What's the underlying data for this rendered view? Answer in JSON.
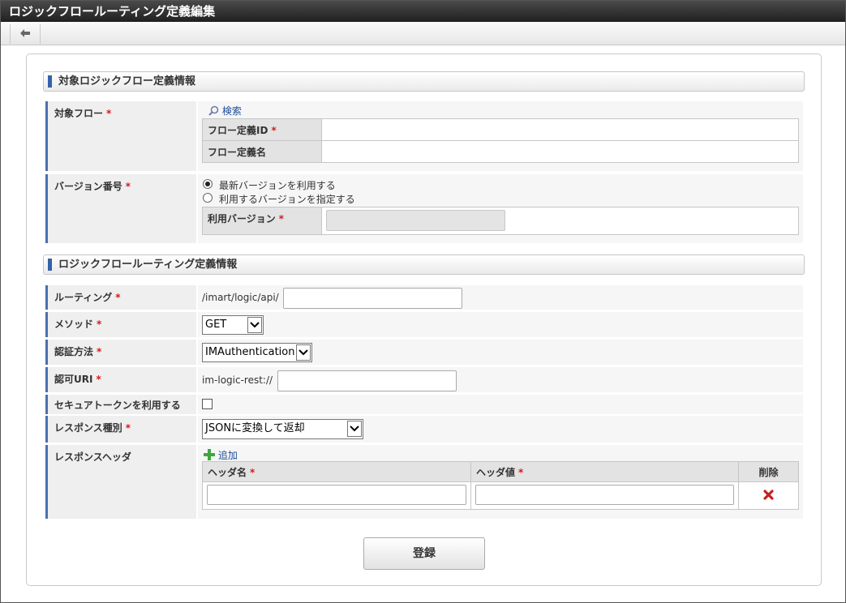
{
  "window": {
    "title": "ロジックフロールーティング定義編集"
  },
  "toolbar": {
    "back_icon": "arrow-left-icon"
  },
  "sections": {
    "target": "対象ロジックフロー定義情報",
    "routing": "ロジックフロールーティング定義情報"
  },
  "required_mark": "*",
  "target_flow": {
    "label": "対象フロー",
    "search_link": "検索",
    "flow_id_label": "フロー定義ID",
    "flow_id_value": "",
    "flow_name_label": "フロー定義名",
    "flow_name_value": ""
  },
  "version": {
    "label": "バージョン番号",
    "option_latest": "最新バージョンを利用する",
    "option_specify": "利用するバージョンを指定する",
    "selected": "latest",
    "use_version_label": "利用バージョン",
    "use_version_value": ""
  },
  "routing": {
    "label": "ルーティング",
    "prefix": "/imart/logic/api/",
    "value": ""
  },
  "method": {
    "label": "メソッド",
    "value": "GET"
  },
  "auth_method": {
    "label": "認証方法",
    "value": "IMAuthentication"
  },
  "auth_uri": {
    "label": "認可URI",
    "prefix": "im-logic-rest://",
    "value": ""
  },
  "secure_token": {
    "label": "セキュアトークンを利用する",
    "checked": false
  },
  "response_type": {
    "label": "レスポンス種別",
    "value": "JSONに変換して返却"
  },
  "response_header": {
    "label": "レスポンスヘッダ",
    "add_link": "追加",
    "columns": {
      "name": "ヘッダ名",
      "value": "ヘッダ値",
      "delete": "削除"
    },
    "rows": [
      {
        "name": "",
        "value": ""
      }
    ]
  },
  "submit_label": "登録",
  "colors": {
    "accent": "#3461a8",
    "required": "#d61a1a",
    "add_icon": "#3fa73f",
    "delete_icon": "#c8201e"
  }
}
